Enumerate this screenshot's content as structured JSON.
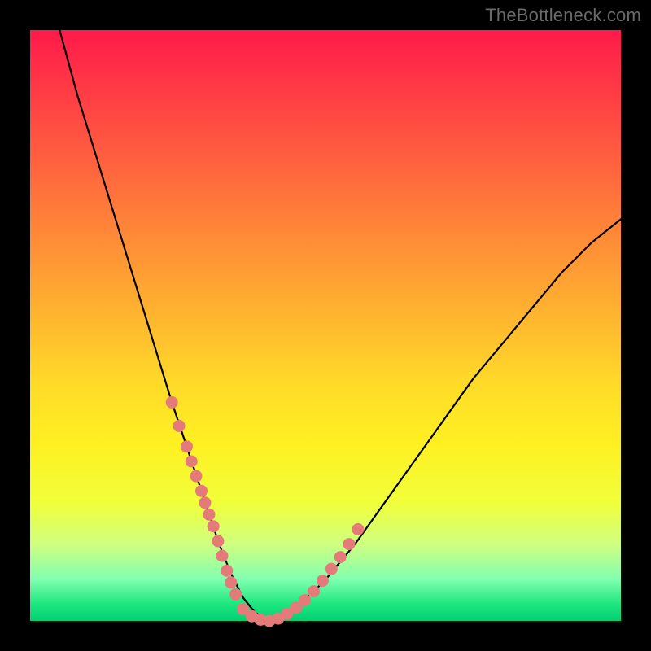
{
  "watermark": "TheBottleneck.com",
  "colors": {
    "frame": "#000000",
    "curve": "#000000",
    "dot": "#e47a7a",
    "gradient_top": "#ff1a4a",
    "gradient_bottom": "#00d070"
  },
  "chart_data": {
    "type": "line",
    "title": "",
    "xlabel": "",
    "ylabel": "",
    "xlim": [
      0,
      100
    ],
    "ylim": [
      0,
      100
    ],
    "grid": false,
    "note": "Axes unlabeled; x is implicit left→right 0–100, y is vertical 0 (bottom) – 100 (top). Values estimated from pixel positions.",
    "series": [
      {
        "name": "curve",
        "x": [
          5,
          8,
          12,
          16,
          20,
          24,
          26,
          28,
          30,
          32,
          34,
          36,
          38,
          40,
          45,
          50,
          55,
          60,
          65,
          70,
          75,
          80,
          85,
          90,
          95,
          100
        ],
        "y": [
          100,
          89,
          76,
          63,
          50,
          37,
          31,
          25,
          19,
          13,
          8,
          4,
          1.5,
          0,
          2,
          7,
          13,
          20,
          27,
          34,
          41,
          47,
          53,
          59,
          64,
          68
        ]
      }
    ],
    "dots": {
      "name": "highlighted-points",
      "x": [
        24.0,
        25.2,
        26.5,
        27.3,
        28.1,
        29.0,
        29.6,
        30.3,
        31.0,
        31.8,
        32.5,
        33.3,
        34.0,
        34.8,
        36.0,
        37.5,
        39.0,
        40.5,
        42.0,
        43.5,
        45.0,
        46.5,
        48.0,
        49.5,
        51.0,
        52.5,
        54.0,
        55.5
      ],
      "y": [
        37.0,
        33.0,
        29.5,
        27.0,
        24.5,
        22.0,
        20.0,
        18.0,
        16.0,
        13.5,
        11.0,
        8.5,
        6.5,
        4.5,
        2.0,
        0.8,
        0.2,
        0.0,
        0.4,
        1.2,
        2.2,
        3.5,
        5.0,
        6.8,
        8.8,
        10.8,
        13.0,
        15.5
      ]
    }
  }
}
